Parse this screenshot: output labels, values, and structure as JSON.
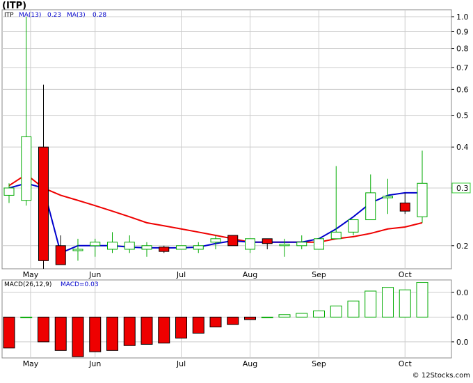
{
  "header": {
    "title": "(ITP)",
    "ticker": "ITP",
    "ma13_label": "MA(13)",
    "ma13_value": "0.23",
    "ma3_label": "MA(3)",
    "ma3_value": "0.28",
    "ma13_color": "#0000cc",
    "ma3_color": "#ee0000"
  },
  "macd_header": {
    "label": "MACD(26,12,9)",
    "macd_label": "MACD=0.03"
  },
  "watermark": "© 12Stocks.com",
  "colors": {
    "up_candle": "#00aa00",
    "down_candle": "#ee0000",
    "ma13": "#0000cc",
    "ma3": "#ee0000",
    "grid": "#cccccc",
    "current_price_box": "#33cc33"
  },
  "chart_data": [
    {
      "type": "candlestick",
      "name": "ITP daily price",
      "scale": "log",
      "ylim": [
        0.17,
        1.05
      ],
      "y_ticks": [
        "1.0",
        "0.9",
        "0.8",
        "0.7",
        "0.6",
        "0.5",
        "0.4",
        "0.3",
        "0.2"
      ],
      "y_tick_values": [
        1.0,
        0.9,
        0.8,
        0.7,
        0.6,
        0.5,
        0.4,
        0.3,
        0.2
      ],
      "current_price_label": "0.3",
      "current_price": 0.3,
      "x_tick_labels": [
        "May",
        "Jun",
        "Jul",
        "Aug",
        "Sep",
        "Oct"
      ],
      "x_tick_index": [
        1.25,
        5,
        10,
        14,
        18,
        23
      ],
      "candles": [
        {
          "o": 0.285,
          "h": 0.31,
          "l": 0.27,
          "c": 0.3
        },
        {
          "o": 0.275,
          "h": 1.0,
          "l": 0.265,
          "c": 0.43
        },
        {
          "o": 0.4,
          "h": 0.62,
          "l": 0.17,
          "c": 0.18
        },
        {
          "o": 0.2,
          "h": 0.215,
          "l": 0.175,
          "c": 0.175
        },
        {
          "o": 0.195,
          "h": 0.21,
          "l": 0.18,
          "c": 0.195
        },
        {
          "o": 0.2,
          "h": 0.21,
          "l": 0.185,
          "c": 0.205
        },
        {
          "o": 0.195,
          "h": 0.22,
          "l": 0.19,
          "c": 0.205
        },
        {
          "o": 0.195,
          "h": 0.215,
          "l": 0.19,
          "c": 0.205
        },
        {
          "o": 0.195,
          "h": 0.205,
          "l": 0.185,
          "c": 0.2
        },
        {
          "o": 0.198,
          "h": 0.2,
          "l": 0.19,
          "c": 0.192
        },
        {
          "o": 0.195,
          "h": 0.2,
          "l": 0.195,
          "c": 0.2
        },
        {
          "o": 0.195,
          "h": 0.205,
          "l": 0.19,
          "c": 0.2
        },
        {
          "o": 0.205,
          "h": 0.215,
          "l": 0.195,
          "c": 0.21
        },
        {
          "o": 0.215,
          "h": 0.215,
          "l": 0.2,
          "c": 0.2
        },
        {
          "o": 0.195,
          "h": 0.21,
          "l": 0.19,
          "c": 0.21
        },
        {
          "o": 0.21,
          "h": 0.21,
          "l": 0.195,
          "c": 0.203
        },
        {
          "o": 0.2,
          "h": 0.21,
          "l": 0.185,
          "c": 0.202
        },
        {
          "o": 0.2,
          "h": 0.215,
          "l": 0.195,
          "c": 0.205
        },
        {
          "o": 0.195,
          "h": 0.21,
          "l": 0.195,
          "c": 0.21
        },
        {
          "o": 0.21,
          "h": 0.35,
          "l": 0.21,
          "c": 0.22
        },
        {
          "o": 0.22,
          "h": 0.24,
          "l": 0.215,
          "c": 0.24
        },
        {
          "o": 0.24,
          "h": 0.33,
          "l": 0.24,
          "c": 0.29
        },
        {
          "o": 0.28,
          "h": 0.32,
          "l": 0.25,
          "c": 0.283
        },
        {
          "o": 0.27,
          "h": 0.29,
          "l": 0.25,
          "c": 0.255
        },
        {
          "o": 0.245,
          "h": 0.39,
          "l": 0.235,
          "c": 0.31
        }
      ],
      "ma3": [
        0.305,
        0.33,
        0.3,
        0.285,
        0.275,
        0.265,
        0.255,
        0.245,
        0.235,
        0.23,
        0.225,
        0.22,
        0.215,
        0.21,
        0.205,
        0.205,
        0.205,
        0.205,
        0.205,
        0.21,
        0.213,
        0.218,
        0.225,
        0.228,
        0.235
      ],
      "ma3_points": 25,
      "ma13": [
        0.3,
        0.31,
        0.3,
        0.19,
        0.2,
        0.2,
        0.2,
        0.198,
        0.197,
        0.197,
        0.197,
        0.198,
        0.203,
        0.207,
        0.205,
        0.205,
        0.205,
        0.205,
        0.21,
        0.225,
        0.245,
        0.27,
        0.285,
        0.29,
        0.29
      ]
    },
    {
      "type": "bar",
      "name": "MACD(26,12,9)",
      "y_ticks": [
        "0.0",
        "0.0",
        "0.0"
      ],
      "y_tick_values": [
        0.02,
        0.0,
        -0.02
      ],
      "x_tick_labels": [
        "May",
        "Jun",
        "Jul",
        "Aug",
        "Sep",
        "Oct"
      ],
      "ylim": [
        -0.033,
        0.03
      ],
      "values": [
        -0.025,
        0.0,
        -0.02,
        -0.027,
        -0.032,
        -0.028,
        -0.027,
        -0.023,
        -0.022,
        -0.021,
        -0.017,
        -0.013,
        -0.008,
        -0.006,
        -0.002,
        0.0,
        0.002,
        0.003,
        0.005,
        0.009,
        0.013,
        0.021,
        0.024,
        0.022,
        0.028
      ]
    }
  ]
}
